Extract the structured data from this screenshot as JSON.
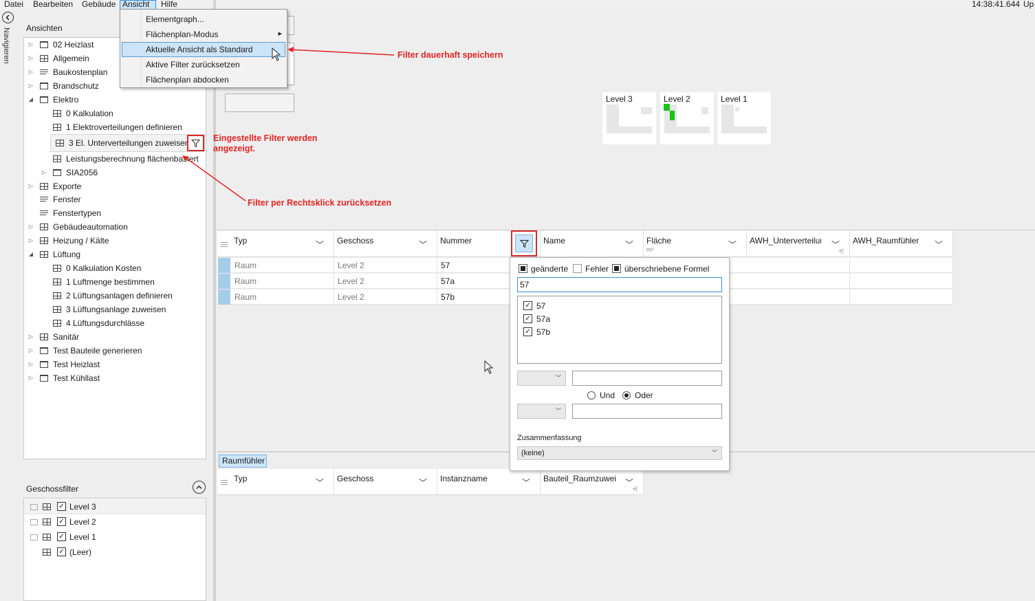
{
  "menubar": {
    "items": [
      "Datei",
      "Bearbeiten",
      "Gebäude",
      "Ansicht",
      "Hilfe"
    ],
    "active": "Ansicht",
    "clock": "14:38:41.644",
    "right_text": "Up"
  },
  "nav": {
    "label": "Navigieren"
  },
  "menu": {
    "items": [
      {
        "label": "Elementgraph..."
      },
      {
        "label": "Flächenplan-Modus"
      },
      {
        "label": "Aktuelle Ansicht als Standard"
      },
      {
        "label": "Aktive Filter zurücksetzen"
      },
      {
        "label": "Flächenplan abdocken"
      }
    ]
  },
  "ansichten": {
    "title": "Ansichten",
    "items": [
      {
        "label": "02 Heizlast"
      },
      {
        "label": "Allgemein"
      },
      {
        "label": "Baukostenplan"
      },
      {
        "label": "Brandschutz"
      },
      {
        "label": "Elektro"
      },
      {
        "label": "0 Kalkulation"
      },
      {
        "label": "1 Elektroverteilungen definieren"
      },
      {
        "label": "3 El. Unterverteilungen zuweisen"
      },
      {
        "label": "Leistungsberechnung flächenbasiert"
      },
      {
        "label": "SIA2056"
      },
      {
        "label": "Exporte"
      },
      {
        "label": "Fenster"
      },
      {
        "label": "Fenstertypen"
      },
      {
        "label": "Gebäudeautomation"
      },
      {
        "label": "Heizung / Kälte"
      },
      {
        "label": "Lüftung"
      },
      {
        "label": "0 Kalkulation Kosten"
      },
      {
        "label": "1 Luftmenge bestimmen"
      },
      {
        "label": "2 Lüftungsanlagen definieren"
      },
      {
        "label": "3 Lüftungsanlage zuweisen"
      },
      {
        "label": "4 Lüftungsdurchlässe"
      },
      {
        "label": "Sanitär"
      },
      {
        "label": "Test Bauteile generieren"
      },
      {
        "label": "Test Heizlast"
      },
      {
        "label": "Test Kühllast"
      }
    ]
  },
  "geschossfilter": {
    "title": "Geschossfilter",
    "items": [
      {
        "label": "Level 3"
      },
      {
        "label": "Level 2"
      },
      {
        "label": "Level 1"
      },
      {
        "label": "(Leer)"
      }
    ]
  },
  "levels": [
    "Level 3",
    "Level 2",
    "Level 1"
  ],
  "main_grid": {
    "columns": [
      "Typ",
      "Geschoss",
      "Nummer",
      "Name",
      "Fläche",
      "AWH_Unterverteilur",
      "AWH_Raumfühler"
    ],
    "flaeche_unit": "m²",
    "rows": [
      [
        "Raum",
        "Level 2",
        "57"
      ],
      [
        "Raum",
        "Level 2",
        "57a"
      ],
      [
        "Raum",
        "Level 2",
        "57b"
      ]
    ]
  },
  "filter_popup": {
    "flags": [
      "geänderte",
      "Fehler",
      "überschriebene Formel"
    ],
    "search_value": "57",
    "values": [
      "57",
      "57a",
      "57b"
    ],
    "und_label": "Und",
    "oder_label": "Oder",
    "zusammenfassung_label": "Zusammenfassung",
    "zusammenfassung_value": "(keine)"
  },
  "bottom": {
    "tab": "Raumfühler",
    "columns": [
      "Typ",
      "Geschoss",
      "Instanzname",
      "Bauteil_Raumzuweis"
    ]
  },
  "annotations": {
    "a1": "Filter dauerhaft speichern",
    "a2_line1": "Eingestellte Filter werden",
    "a2_line2": "angezeigt.",
    "a3": "Filter per Rechtsklick zurücksetzen"
  },
  "colors": {
    "accent": "#cce4f7",
    "annotation": "#e02424",
    "level_highlight": "#19c419",
    "row_marker": "#a6cde8"
  }
}
